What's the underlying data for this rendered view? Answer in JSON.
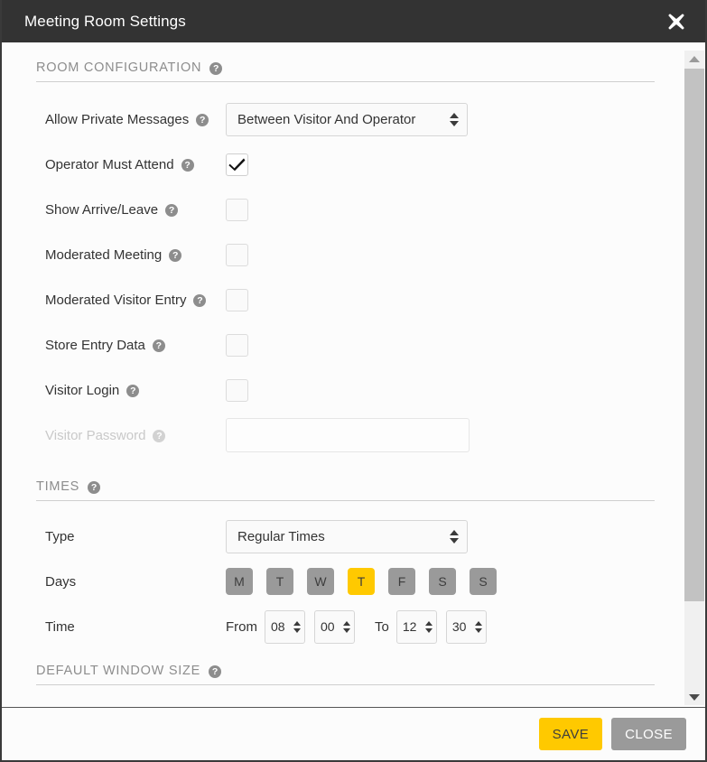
{
  "titlebar": {
    "title": "Meeting Room Settings",
    "close_icon": "close-icon"
  },
  "sections": {
    "room_configuration": {
      "heading": "ROOM CONFIGURATION",
      "rows": {
        "allow_private_messages": {
          "label": "Allow Private Messages",
          "value": "Between Visitor And Operator"
        },
        "operator_must_attend": {
          "label": "Operator Must Attend",
          "checked": "true"
        },
        "show_arrive_leave": {
          "label": "Show Arrive/Leave",
          "checked": "false"
        },
        "moderated_meeting": {
          "label": "Moderated Meeting",
          "checked": "false"
        },
        "moderated_visitor_entry": {
          "label": "Moderated Visitor Entry",
          "checked": "false"
        },
        "store_entry_data": {
          "label": "Store Entry Data",
          "checked": "false"
        },
        "visitor_login": {
          "label": "Visitor Login",
          "checked": "false"
        },
        "visitor_password": {
          "label": "Visitor Password",
          "value": "",
          "placeholder": ""
        }
      }
    },
    "times": {
      "heading": "TIMES",
      "type_label": "Type",
      "type_value": "Regular Times",
      "days_label": "Days",
      "days": [
        {
          "letter": "M",
          "selected": "false"
        },
        {
          "letter": "T",
          "selected": "false"
        },
        {
          "letter": "W",
          "selected": "false"
        },
        {
          "letter": "T",
          "selected": "true"
        },
        {
          "letter": "F",
          "selected": "false"
        },
        {
          "letter": "S",
          "selected": "false"
        },
        {
          "letter": "S",
          "selected": "false"
        }
      ],
      "time_label": "Time",
      "from_label": "From",
      "from_hour": "08",
      "from_minute": "00",
      "to_label": "To",
      "to_hour": "12",
      "to_minute": "30"
    },
    "default_window_size": {
      "heading": "DEFAULT WINDOW SIZE"
    }
  },
  "help_icon_glyph": "?",
  "footer": {
    "save_label": "SAVE",
    "close_label": "CLOSE"
  },
  "colors": {
    "accent_yellow": "#ffc900",
    "titlebar": "#333333",
    "grey_button": "#9a9a9a"
  }
}
